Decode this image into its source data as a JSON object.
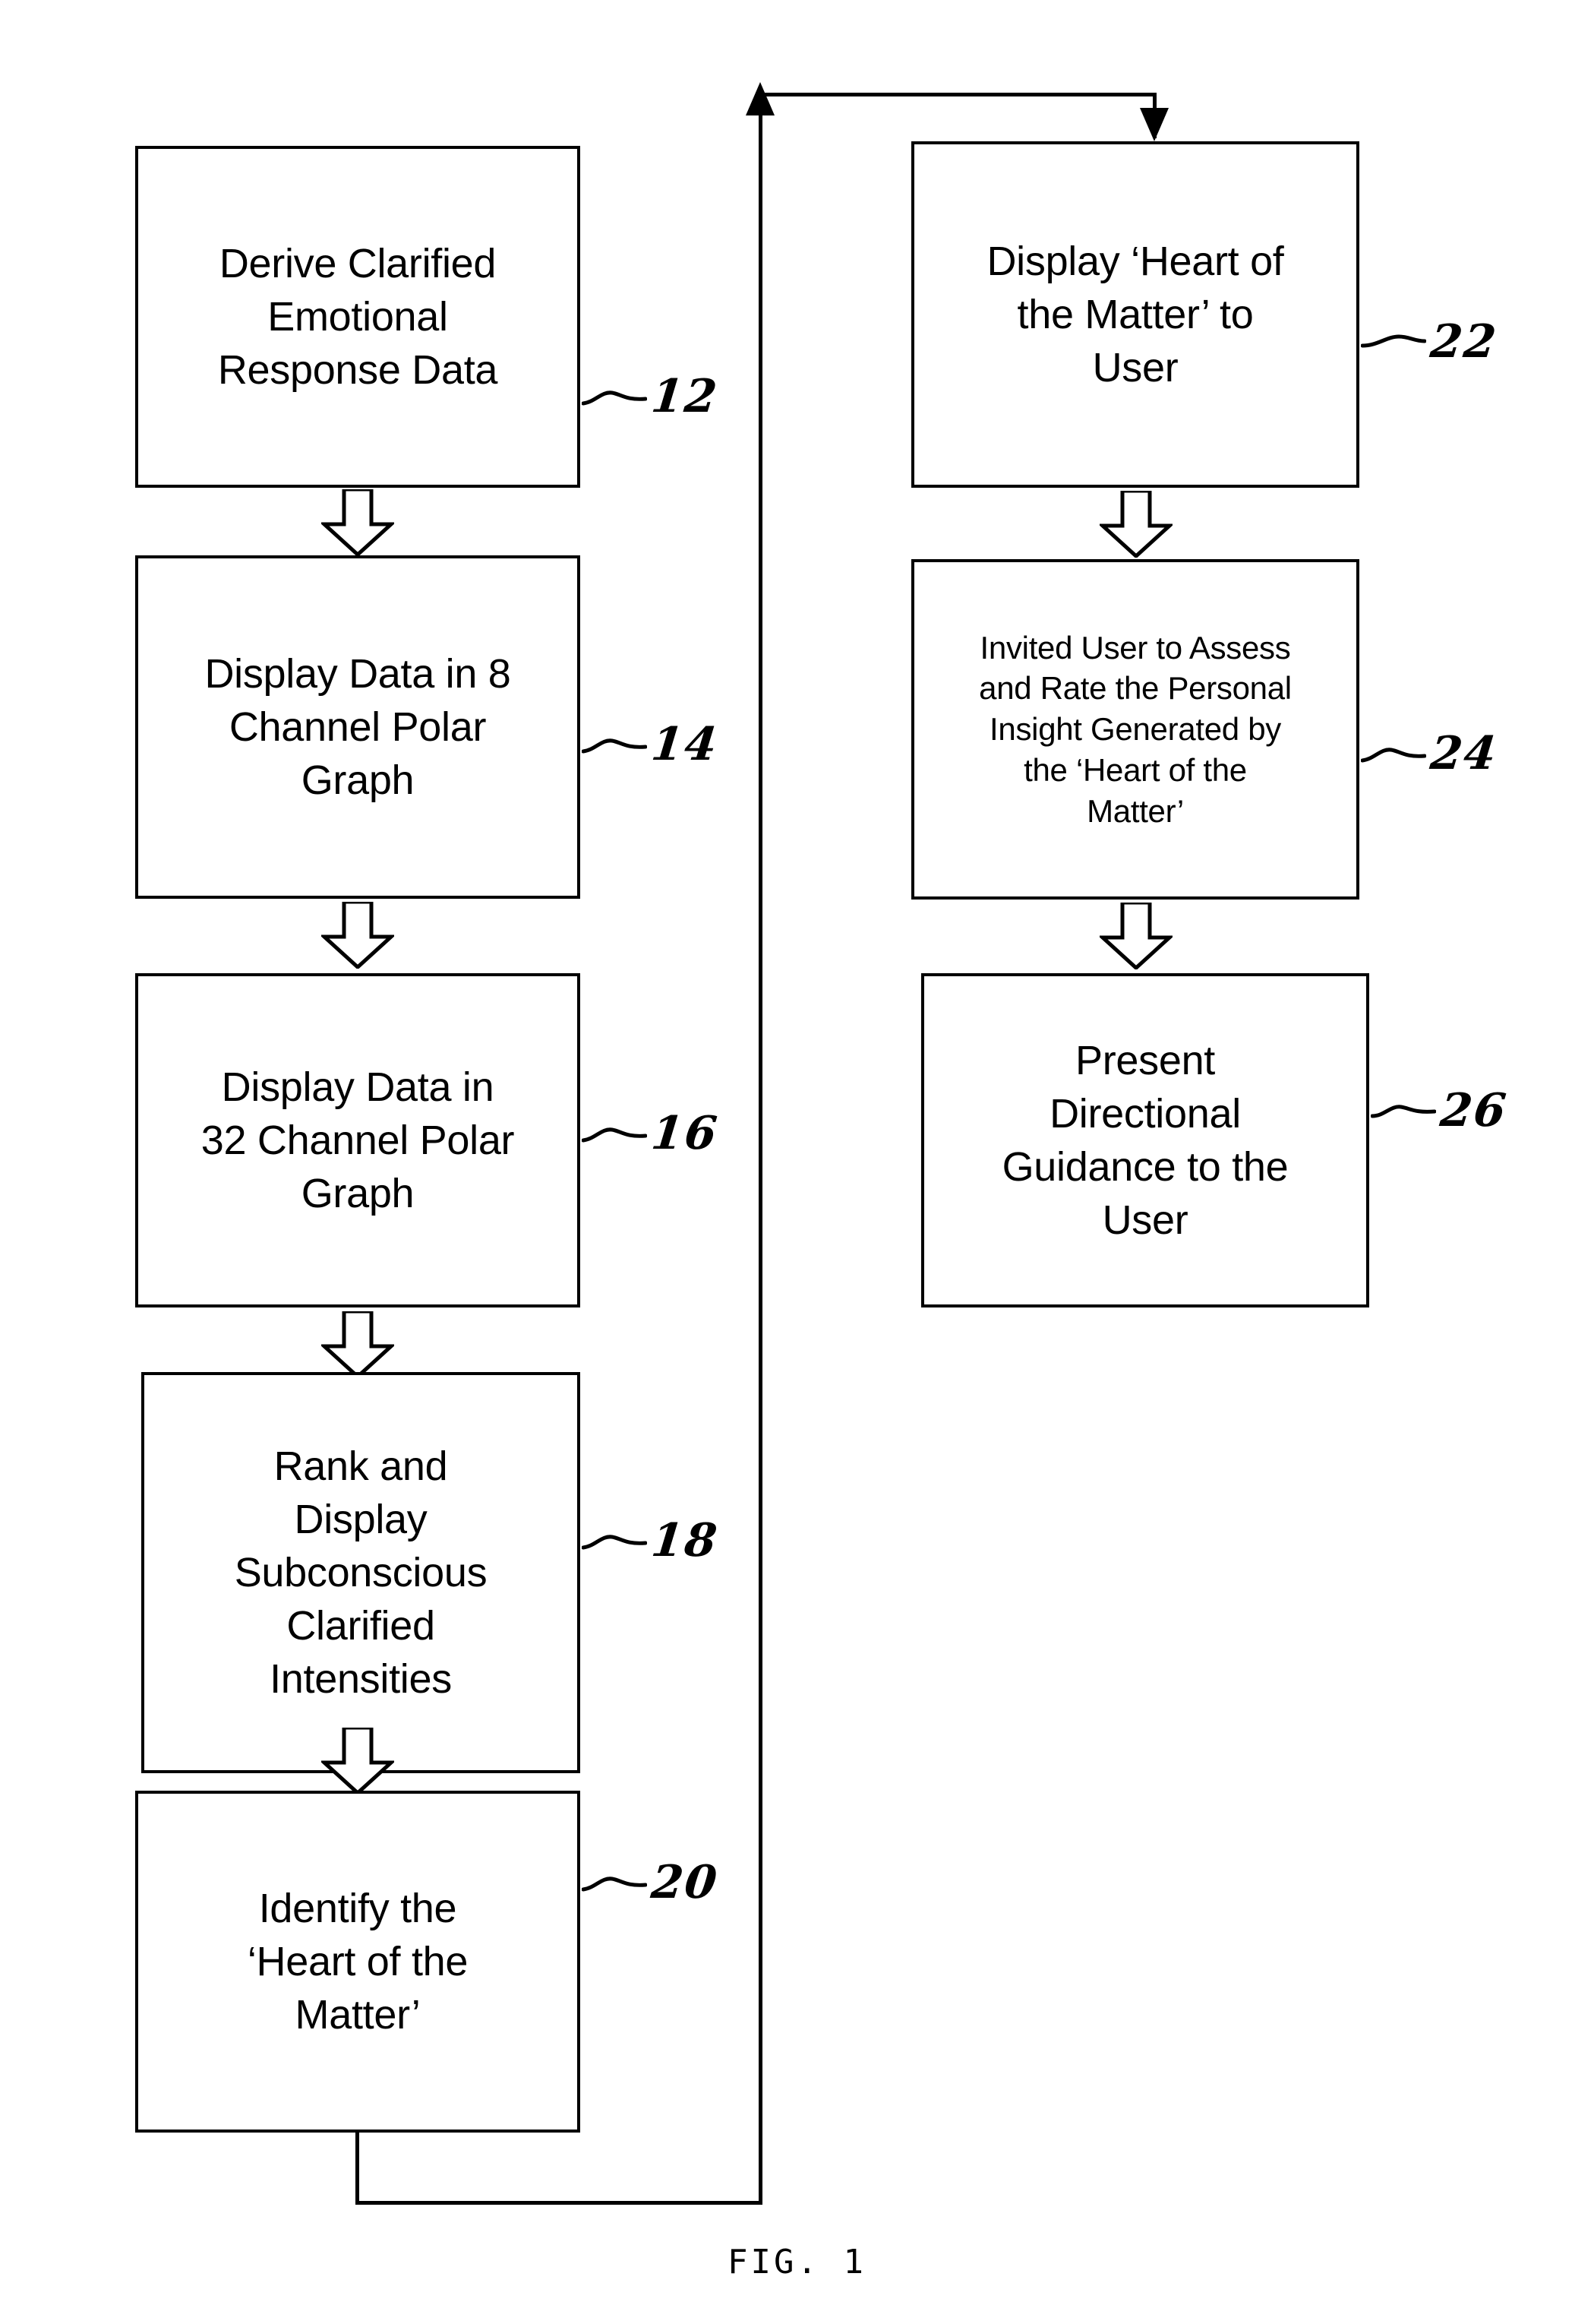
{
  "figure": {
    "caption": "FIG. 1",
    "type": "flowchart"
  },
  "flowchart": {
    "left_column": [
      {
        "ref": "12",
        "text": "Derive Clarified\nEmotional\nResponse Data"
      },
      {
        "ref": "14",
        "text": "Display Data in 8\nChannel Polar\nGraph"
      },
      {
        "ref": "16",
        "text": "Display Data in\n32 Channel Polar\nGraph"
      },
      {
        "ref": "18",
        "text": "Rank and\nDisplay\nSubconscious\nClarified\nIntensities"
      },
      {
        "ref": "20",
        "text": "Identify the\n‘Heart of the\nMatter’"
      }
    ],
    "right_column": [
      {
        "ref": "22",
        "text": "Display ‘Heart of\nthe Matter’ to\nUser"
      },
      {
        "ref": "24",
        "text": "Invited User to Assess\nand Rate the Personal\nInsight Generated by\nthe ‘Heart of the\nMatter’"
      },
      {
        "ref": "26",
        "text": "Present\nDirectional\nGuidance to the\nUser"
      }
    ],
    "connectors": {
      "block_arrow_count": 6,
      "feedback_loop_from": "20",
      "feedback_loop_to": "22"
    }
  }
}
